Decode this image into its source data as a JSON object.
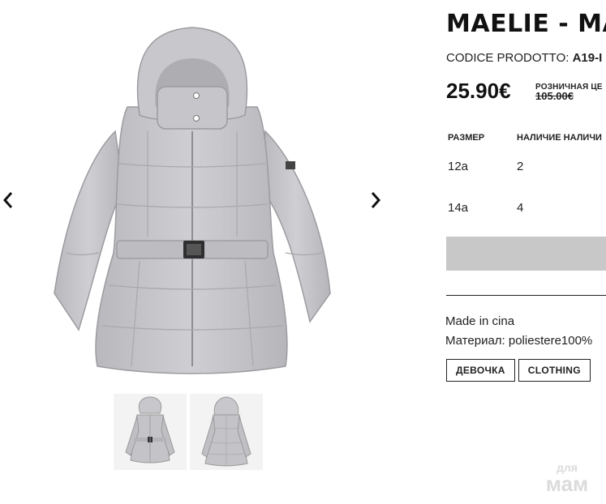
{
  "product": {
    "title": "MAELIE - MA",
    "code_label": "CODICE PRODOTTO:",
    "code_value": "A19-I",
    "price": "25.90€",
    "retail_label": "РОЗНИЧНАЯ ЦЕ",
    "old_price": "105.00€",
    "made_in": "Made in cina",
    "material": "Материал: poliestere100%"
  },
  "size_table": {
    "headers": {
      "size": "РАЗМЕР",
      "availability": "НАЛИЧИЕ НАЛИЧИ"
    },
    "rows": [
      {
        "size": "12a",
        "qty": "2"
      },
      {
        "size": "14a",
        "qty": "4"
      }
    ]
  },
  "tags": [
    "ДЕВОЧКА",
    "CLOTHING"
  ],
  "watermark": {
    "line1": "для",
    "line2": "мам"
  },
  "icons": {
    "prev": "chevron-left-icon",
    "next": "chevron-right-icon"
  },
  "colors": {
    "jacket": "#c4c4c8",
    "button_disabled": "#c8c8c8",
    "text": "#111111"
  }
}
